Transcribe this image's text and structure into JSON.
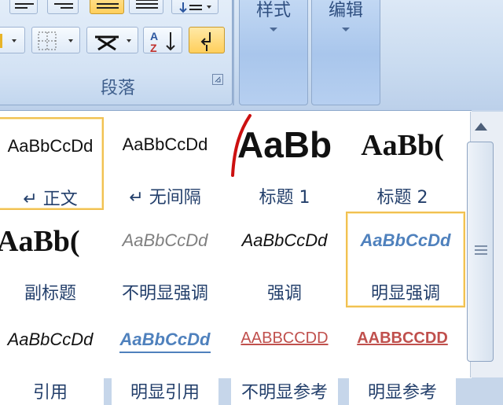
{
  "ribbon": {
    "paragraph_group_label": "段落",
    "styles_label": "样式",
    "editing_label": "编辑"
  },
  "gallery": {
    "tiles": [
      {
        "preview": "AaBbCcDd",
        "name": "↵ 正文"
      },
      {
        "preview": "AaBbCcDd",
        "name": "↵ 无间隔"
      },
      {
        "preview": "AaBb",
        "name": "标题 1"
      },
      {
        "preview": "AaBb(",
        "name": "标题 2"
      },
      {
        "preview": "AaBb(",
        "name": "副标题"
      },
      {
        "preview": "AaBbCcDd",
        "name": "不明显强调"
      },
      {
        "preview": "AaBbCcDd",
        "name": "强调"
      },
      {
        "preview": "AaBbCcDd",
        "name": "明显强调"
      },
      {
        "preview": "AaBbCcDd",
        "name": "引用"
      },
      {
        "preview": "AaBbCcDd",
        "name": "明显引用"
      },
      {
        "preview": "AABBCCDD",
        "name": "不明显参考"
      },
      {
        "preview": "AABBCCDD",
        "name": "明显参考"
      }
    ]
  },
  "colors": {
    "accent_selected_border": "#f1c152",
    "style_name_text": "#233f6b",
    "subtle_reference": "#c0504d",
    "emphasis_blue": "#4f81bd"
  },
  "icons": [
    "align-left-icon",
    "align-center-icon",
    "align-right-icon",
    "justify-icon",
    "distributed-icon",
    "line-spacing-icon",
    "shading-icon",
    "borders-icon",
    "chinese-layout-icon",
    "sort-icon",
    "show-hide-marks-icon",
    "dialog-launcher-icon"
  ]
}
